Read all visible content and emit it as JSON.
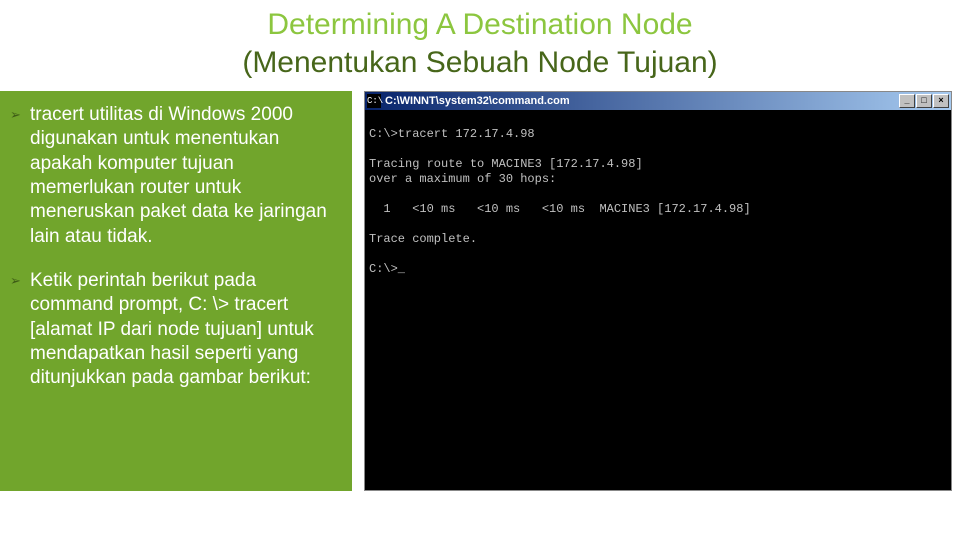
{
  "heading": {
    "title": "Determining A Destination Node",
    "subtitle": "(Menentukan Sebuah Node Tujuan)"
  },
  "bullets": [
    {
      "glyph": "➢",
      "text": "tracert utilitas di Windows 2000 digunakan untuk menentukan apakah komputer tujuan memerlukan router untuk meneruskan paket data ke jaringan lain atau tidak."
    },
    {
      "glyph": "➢",
      "text": "Ketik perintah berikut pada command prompt, C: \\> tracert [alamat IP dari node tujuan] untuk mendapatkan hasil seperti yang ditunjukkan pada gambar berikut:"
    }
  ],
  "cmd": {
    "titlebar": "C:\\WINNT\\system32\\command.com",
    "buttons": {
      "min": "_",
      "max": "□",
      "close": "×"
    },
    "output": "\nC:\\>tracert 172.17.4.98\n\nTracing route to MACINE3 [172.17.4.98]\nover a maximum of 30 hops:\n\n  1   <10 ms   <10 ms   <10 ms  MACINE3 [172.17.4.98]\n\nTrace complete.\n\nC:\\>_"
  }
}
